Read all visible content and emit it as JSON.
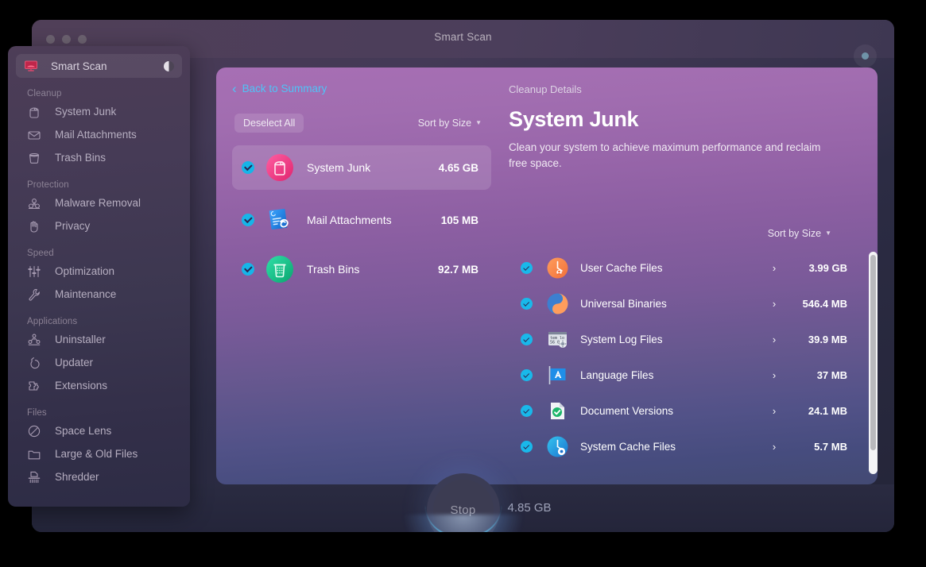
{
  "window": {
    "title": "Smart Scan",
    "traffic_lights": [
      "close",
      "minimize",
      "zoom"
    ],
    "title_right_icon": "status-dot-icon"
  },
  "sidebar": {
    "smart_scan": {
      "label": "Smart Scan",
      "icon": "monitor-icon",
      "toggle": "half-circle-toggle-icon"
    },
    "sections": [
      {
        "title": "Cleanup",
        "items": [
          {
            "label": "System Junk",
            "icon": "trash-can-icon"
          },
          {
            "label": "Mail Attachments",
            "icon": "envelope-icon"
          },
          {
            "label": "Trash Bins",
            "icon": "bin-icon"
          }
        ]
      },
      {
        "title": "Protection",
        "items": [
          {
            "label": "Malware Removal",
            "icon": "biohazard-icon"
          },
          {
            "label": "Privacy",
            "icon": "hand-icon"
          }
        ]
      },
      {
        "title": "Speed",
        "items": [
          {
            "label": "Optimization",
            "icon": "sliders-icon"
          },
          {
            "label": "Maintenance",
            "icon": "wrench-icon"
          }
        ]
      },
      {
        "title": "Applications",
        "items": [
          {
            "label": "Uninstaller",
            "icon": "apps-grid-icon"
          },
          {
            "label": "Updater",
            "icon": "refresh-arrow-icon"
          },
          {
            "label": "Extensions",
            "icon": "puzzle-piece-icon"
          }
        ]
      },
      {
        "title": "Files",
        "items": [
          {
            "label": "Space Lens",
            "icon": "lens-circle-icon"
          },
          {
            "label": "Large & Old Files",
            "icon": "folder-icon"
          },
          {
            "label": "Shredder",
            "icon": "shredder-icon"
          }
        ]
      }
    ]
  },
  "panel": {
    "back_link": {
      "label": "Back to Summary",
      "icon": "chevron-left-icon"
    },
    "section_label": "Cleanup Details",
    "left": {
      "deselect_all_label": "Deselect All",
      "sort_label": "Sort by Size",
      "sort_caret": "caret-down-icon",
      "categories": [
        {
          "name": "System Junk",
          "size": "4.65 GB",
          "checked": true,
          "selected": true,
          "icon": "system-junk-icon"
        },
        {
          "name": "Mail Attachments",
          "size": "105 MB",
          "checked": true,
          "selected": false,
          "icon": "mail-attachment-icon"
        },
        {
          "name": "Trash Bins",
          "size": "92.7 MB",
          "checked": true,
          "selected": false,
          "icon": "trash-bins-icon"
        }
      ]
    },
    "detail": {
      "title": "System Junk",
      "description": "Clean your system to achieve maximum performance and reclaim free space.",
      "sort_label": "Sort by Size",
      "sort_caret": "caret-down-icon",
      "items": [
        {
          "name": "User Cache Files",
          "size": "3.99 GB",
          "checked": true,
          "icon": "user-cache-icon",
          "arrow": "›"
        },
        {
          "name": "Universal Binaries",
          "size": "546.4 MB",
          "checked": true,
          "icon": "universal-binaries-icon",
          "arrow": "›"
        },
        {
          "name": "System Log Files",
          "size": "39.9 MB",
          "checked": true,
          "icon": "system-log-icon",
          "arrow": "›"
        },
        {
          "name": "Language Files",
          "size": "37 MB",
          "checked": true,
          "icon": "language-files-icon",
          "arrow": "›"
        },
        {
          "name": "Document Versions",
          "size": "24.1 MB",
          "checked": true,
          "icon": "document-versions-icon",
          "arrow": "›"
        },
        {
          "name": "System Cache Files",
          "size": "5.7 MB",
          "checked": true,
          "icon": "system-cache-icon",
          "arrow": "›"
        }
      ]
    }
  },
  "footer": {
    "stop_label": "Stop",
    "total_size": "4.85 GB"
  },
  "colors": {
    "accent_blue": "#4fc3f7",
    "checkbox": "#16b5e8",
    "panel_top": "#a76fb4",
    "panel_bottom": "#434a73",
    "window_bg": "#2c2c44",
    "sidebar_bg": "#3c3750"
  }
}
